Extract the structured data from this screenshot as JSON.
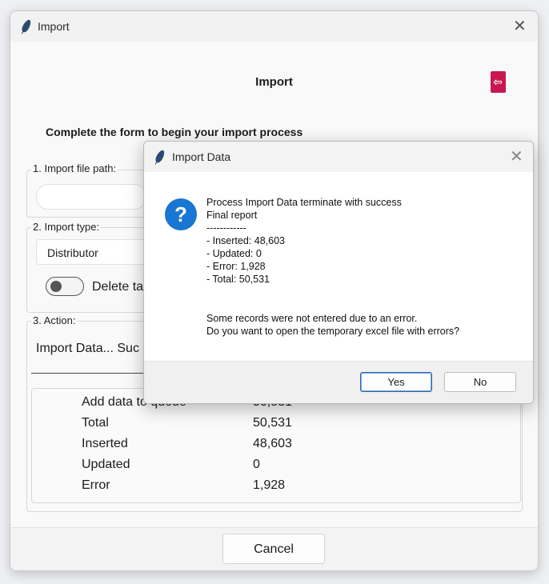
{
  "window": {
    "title": "Import",
    "close_glyph": "✕",
    "header_title": "Import",
    "exit_icon": "exit-icon",
    "exit_color": "#c8174f",
    "intro": "Complete the form to begin your import process"
  },
  "form": {
    "file_path": {
      "label": "1. Import file path:",
      "value": ""
    },
    "import_type": {
      "label": "2. Import type:",
      "selected": "Distributor",
      "toggle_label": "Delete ta",
      "toggle_on": false
    },
    "action": {
      "label": "3. Action:",
      "status": "Import Data... Suc"
    }
  },
  "results": [
    {
      "label": "Add data to queue",
      "value": "50,531"
    },
    {
      "label": "Total",
      "value": "50,531"
    },
    {
      "label": "Inserted",
      "value": "48,603"
    },
    {
      "label": "Updated",
      "value": "0"
    },
    {
      "label": "Error",
      "value": "1,928"
    }
  ],
  "footer": {
    "cancel_label": "Cancel"
  },
  "dialog": {
    "title": "Import Data",
    "close_glyph": "✕",
    "icon": "question-icon",
    "icon_color": "#1976d2",
    "icon_glyph": "?",
    "lines": [
      "Process Import Data terminate with success",
      "Final report",
      "------------",
      "- Inserted: 48,603",
      "- Updated: 0",
      "- Error: 1,928",
      "- Total: 50,531"
    ],
    "question_lines": [
      "Some records were not entered due to an error.",
      "Do you want to open the temporary excel file with errors?"
    ],
    "yes_label": "Yes",
    "no_label": "No"
  }
}
